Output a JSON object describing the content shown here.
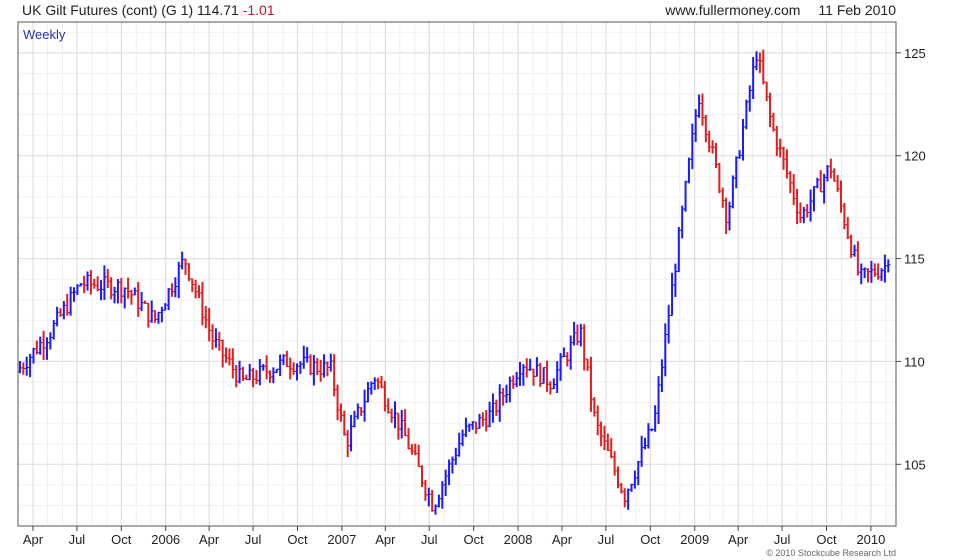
{
  "header": {
    "title": "UK Gilt Futures (cont) (G 1)",
    "last_price": "114.71",
    "change": "-1.01",
    "source": "www.fullermoney.com",
    "date": "11 Feb 2010"
  },
  "copyright": "© 2010 Stockcube Research Ltd",
  "colors": {
    "up": "#1a1aff",
    "down": "#e31c1c",
    "grid": "#dcdcdc",
    "frame": "#555555",
    "change_negative": "#c8102e"
  },
  "chart_data": {
    "type": "line",
    "style": "weekly OHLC bars, blue = up week, red = down week",
    "period_label": "Weekly",
    "grid": true,
    "y_axis_side": "right",
    "ylim": [
      102,
      126.5
    ],
    "y_ticks": [
      105,
      110,
      115,
      120,
      125
    ],
    "x_ticks": [
      "Apr",
      "Jul",
      "Oct",
      "2006",
      "Apr",
      "Jul",
      "Oct",
      "2007",
      "Apr",
      "Jul",
      "Oct",
      "2008",
      "Apr",
      "Jul",
      "Oct",
      "2009",
      "Apr",
      "Jul",
      "Oct",
      "2010"
    ],
    "series": [
      {
        "x": [
          "2005-03",
          "2005-05",
          "2005-07",
          "2005-10",
          "2005-12",
          "2006-02",
          "2006-04",
          "2006-06",
          "2006-09",
          "2006-12",
          "2007-01",
          "2007-03",
          "2007-05",
          "2007-07",
          "2007-09",
          "2007-11",
          "2008-01",
          "2008-03",
          "2008-05",
          "2008-06",
          "2008-08",
          "2008-10",
          "2008-11",
          "2009-01",
          "2009-03",
          "2009-05",
          "2009-06",
          "2009-08",
          "2009-10",
          "2009-12",
          "2010-02"
        ],
        "values": [
          109.5,
          111.5,
          113.8,
          113.6,
          112.0,
          115.0,
          111.0,
          109.0,
          110.0,
          109.6,
          106.0,
          109.3,
          106.5,
          103.0,
          106.5,
          107.5,
          110.0,
          109.0,
          111.5,
          107.0,
          103.5,
          107.0,
          112.5,
          123.0,
          117.0,
          125.0,
          121.5,
          117.0,
          119.5,
          114.0,
          114.71
        ]
      }
    ]
  }
}
